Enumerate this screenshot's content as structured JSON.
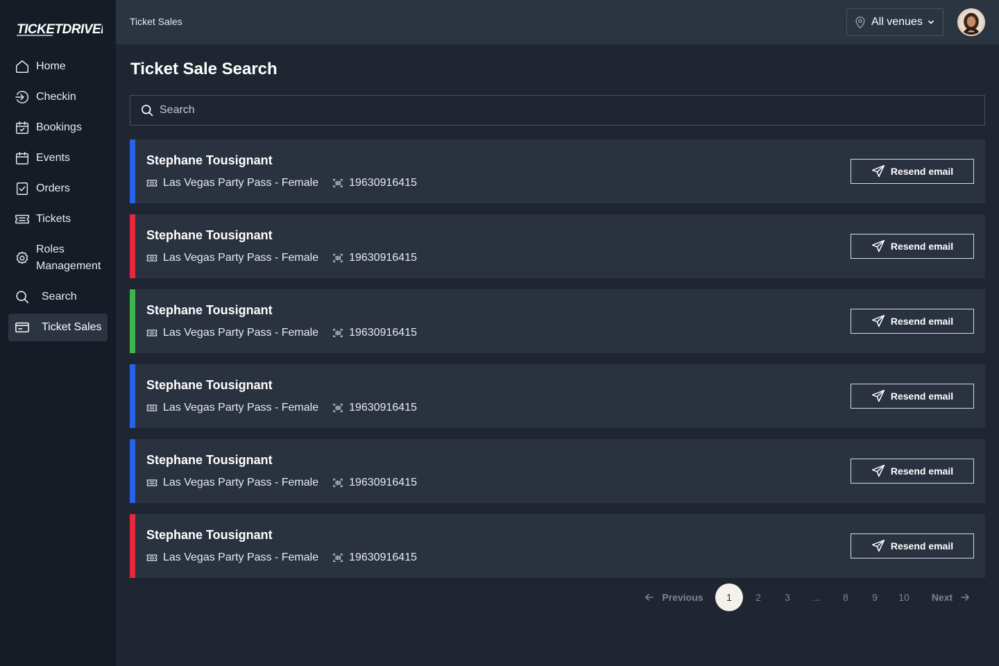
{
  "brand": {
    "logo_text": "TICKETDRIVER"
  },
  "sidebar": {
    "items": [
      {
        "label": "Home",
        "icon": "home-icon"
      },
      {
        "label": "Checkin",
        "icon": "checkin-icon"
      },
      {
        "label": "Bookings",
        "icon": "calendar-check-icon"
      },
      {
        "label": "Events",
        "icon": "calendar-icon"
      },
      {
        "label": "Orders",
        "icon": "clipboard-check-icon"
      },
      {
        "label": "Tickets",
        "icon": "ticket-icon"
      },
      {
        "label": "Roles",
        "label2": "Management",
        "icon": "gear-icon"
      },
      {
        "label": "Search",
        "icon": "search-icon"
      },
      {
        "label": "Ticket Sales",
        "icon": "ticket-sales-icon",
        "active": true
      }
    ]
  },
  "header": {
    "breadcrumb": "Ticket Sales",
    "venue_select": "All venues"
  },
  "main": {
    "title": "Ticket Sale Search",
    "search_placeholder": "Search",
    "sales": [
      {
        "name": "Stephane Tousignant",
        "ticket": "Las Vegas Party Pass - Female",
        "code": "19630916415",
        "accent": "#2563eb",
        "action": "Resend email"
      },
      {
        "name": "Stephane Tousignant",
        "ticket": "Las Vegas Party Pass - Female",
        "code": "19630916415",
        "accent": "#e5283d",
        "action": "Resend email"
      },
      {
        "name": "Stephane Tousignant",
        "ticket": "Las Vegas Party Pass - Female",
        "code": "19630916415",
        "accent": "#3cb54a",
        "action": "Resend email"
      },
      {
        "name": "Stephane Tousignant",
        "ticket": "Las Vegas Party Pass - Female",
        "code": "19630916415",
        "accent": "#2563eb",
        "action": "Resend email"
      },
      {
        "name": "Stephane Tousignant",
        "ticket": "Las Vegas Party Pass - Female",
        "code": "19630916415",
        "accent": "#2563eb",
        "action": "Resend email"
      },
      {
        "name": "Stephane Tousignant",
        "ticket": "Las Vegas Party Pass - Female",
        "code": "19630916415",
        "accent": "#e5283d",
        "action": "Resend email"
      }
    ]
  },
  "pagination": {
    "previous": "Previous",
    "next": "Next",
    "pages": [
      "1",
      "2",
      "3",
      "...",
      "8",
      "9",
      "10"
    ],
    "current": "1"
  }
}
